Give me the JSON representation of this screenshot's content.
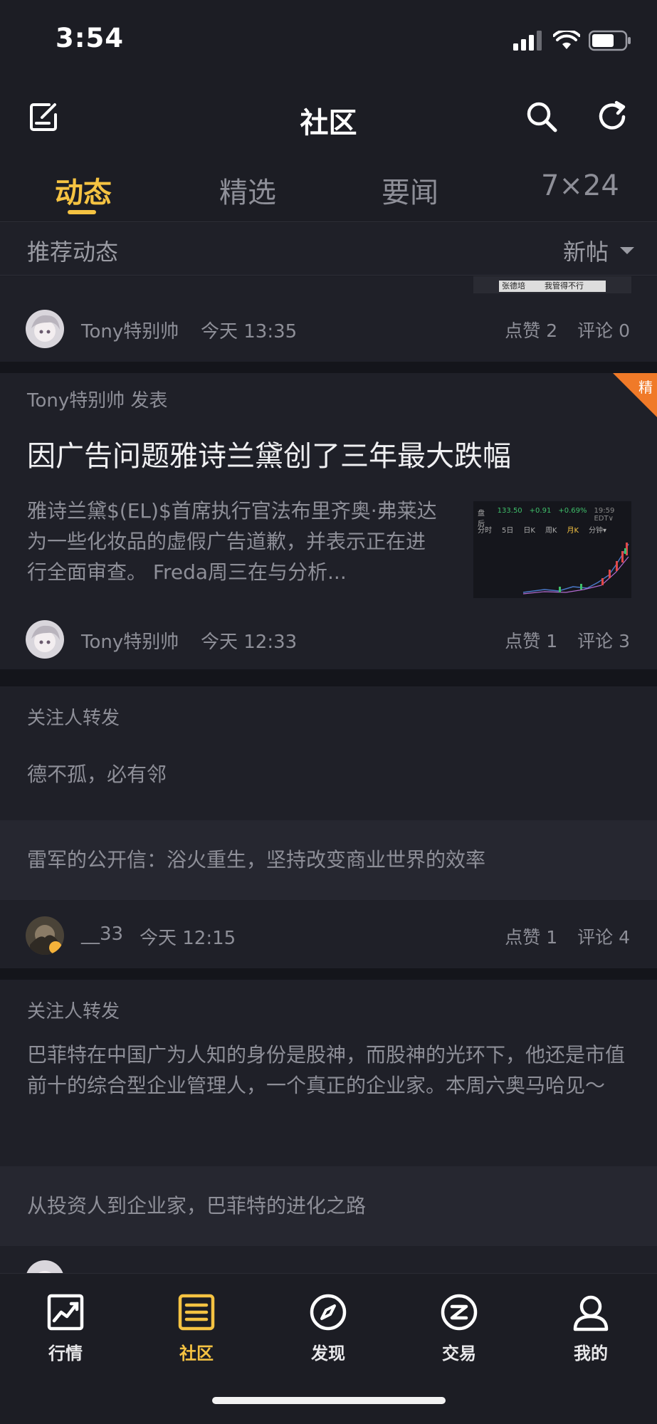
{
  "status_bar": {
    "time": "3:54"
  },
  "header": {
    "title": "社区"
  },
  "tabs": [
    {
      "label": "动态",
      "active": true
    },
    {
      "label": "精选",
      "active": false
    },
    {
      "label": "要闻",
      "active": false
    },
    {
      "label": "7×24",
      "active": false
    }
  ],
  "subbar": {
    "left": "推荐动态",
    "sort": "新帖"
  },
  "thumb0": {
    "caption_left": "张德培",
    "caption_right": "我管得不行"
  },
  "post0": {
    "author": "Tony特别帅",
    "time": "今天 13:35",
    "likes": "点赞 2",
    "comments": "评论 0"
  },
  "post1": {
    "label": "Tony特别帅 发表",
    "badge": "精",
    "title": "因广告问题雅诗兰黛创了三年最大跌幅",
    "body": "雅诗兰黛$(EL)$首席执行官法布里齐奥·弗莱达为一些化妆品的虚假广告道歉，并表示正在进行全面审查。 Freda周三在与分析...",
    "author": "Tony特别帅",
    "time": "今天 12:33",
    "likes": "点赞 1",
    "comments": "评论 3",
    "thumb": {
      "row1": [
        "盘后",
        "133.50",
        "+0.91",
        "+0.69%",
        "19:59 EDT∨"
      ],
      "row2": [
        "分时",
        "5日",
        "日K",
        "周K",
        "月K",
        "分钟▾"
      ]
    }
  },
  "post2": {
    "label": "关注人转发",
    "text": "德不孤，必有邻",
    "quote": "雷军的公开信：浴火重生，坚持改变商业世界的效率",
    "author": "__33",
    "time": "今天 12:15",
    "likes": "点赞 1",
    "comments": "评论 4"
  },
  "post3": {
    "label": "关注人转发",
    "text": "巴菲特在中国广为人知的身份是股神，而股神的光环下，他还是市值前十的综合型企业管理人，一个真正的企业家。本周六奥马哈见～",
    "quote": "从投资人到企业家，巴菲特的进化之路"
  },
  "bottom_nav": [
    {
      "label": "行情",
      "icon": "chart-icon",
      "active": false
    },
    {
      "label": "社区",
      "icon": "community-icon",
      "active": true
    },
    {
      "label": "发现",
      "icon": "compass-icon",
      "active": false
    },
    {
      "label": "交易",
      "icon": "trade-icon",
      "active": false
    },
    {
      "label": "我的",
      "icon": "profile-icon",
      "active": false
    }
  ],
  "colors": {
    "accent": "#f5c342",
    "background": "#1c1d24",
    "card": "#1f2028",
    "badge": "#f07a28"
  }
}
